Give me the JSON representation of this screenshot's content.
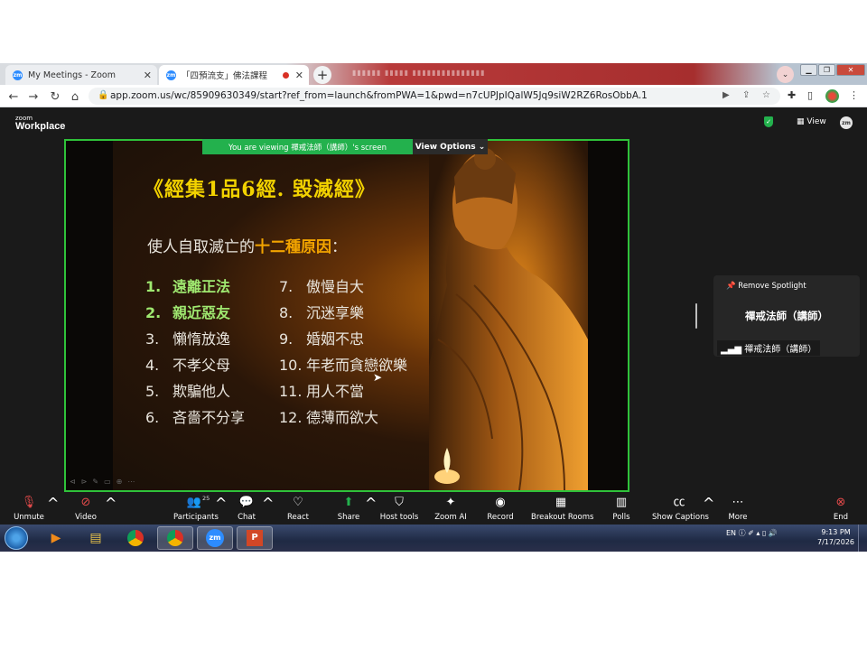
{
  "browser": {
    "tabs": [
      {
        "title": "My Meetings - Zoom",
        "active": false
      },
      {
        "title": "「四預流支」佛法課程",
        "active": true,
        "recording": true
      }
    ],
    "new_tab": "+",
    "tab_dropdown": "⌄",
    "url": "app.zoom.us/wc/85909630349/start?ref_from=launch&fromPWA=1&pwd=n7cUPJpIQalW5Jq9siW2RZ6RosObbA.1"
  },
  "zoom": {
    "logo_small": "zoom",
    "logo": "Workplace",
    "view_label": "View",
    "avatar_text": "zm",
    "viewing_banner": "You are viewing  禪戒法師（講師）'s screen",
    "view_options": "View Options",
    "spotlight": {
      "remove": "Remove Spotlight",
      "name": "禪戒法師（講師）",
      "tile_label": "禪戒法師（講師）"
    }
  },
  "slide": {
    "title": "《經集1品6經. 毀滅經》",
    "subtitle_prefix": "使人自取滅亡的",
    "subtitle_highlight": "十二種原因",
    "subtitle_suffix": "：",
    "items_left": [
      {
        "num": "1.",
        "text": "遠離正法"
      },
      {
        "num": "2.",
        "text": "親近惡友"
      },
      {
        "num": "3.",
        "text": "懶惰放逸"
      },
      {
        "num": "4.",
        "text": "不孝父母"
      },
      {
        "num": "5.",
        "text": "欺騙他人"
      },
      {
        "num": "6.",
        "text": "吝嗇不分享"
      }
    ],
    "items_right": [
      {
        "num": "7.",
        "text": "傲慢自大"
      },
      {
        "num": "8.",
        "text": "沉迷享樂"
      },
      {
        "num": "9.",
        "text": "婚姻不忠"
      },
      {
        "num": "10.",
        "text": "年老而貪戀欲樂"
      },
      {
        "num": "11.",
        "text": "用人不當"
      },
      {
        "num": "12.",
        "text": "德薄而欲大"
      }
    ],
    "colors": {
      "title": "#f2d200",
      "highlight": "#f2a400",
      "green": "#9fe870"
    }
  },
  "toolbar": {
    "unmute": "Unmute",
    "video": "Video",
    "participants": "Participants",
    "participants_count": "25",
    "chat": "Chat",
    "react": "React",
    "share": "Share",
    "host_tools": "Host tools",
    "zoom_ai": "Zoom AI",
    "record": "Record",
    "breakout": "Breakout Rooms",
    "polls": "Polls",
    "captions": "Show Captions",
    "more": "More",
    "end": "End"
  },
  "taskbar": {
    "lang": "EN",
    "time": "9:13 PM",
    "date": "7/17/2026",
    "zoom_app": "zm"
  }
}
